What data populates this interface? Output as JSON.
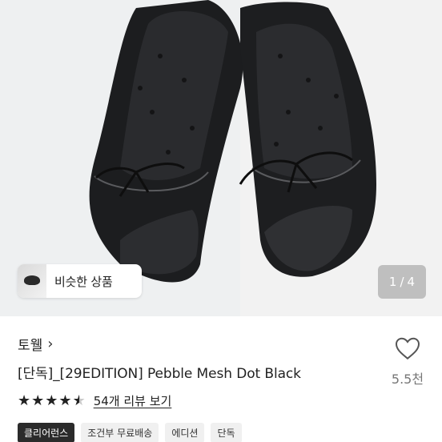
{
  "hero": {
    "similar_button_label": "비슷한 상품",
    "page_current": "1",
    "page_separator": "/",
    "page_total": "4"
  },
  "product": {
    "brand": "토웰",
    "title": "[단독]_[29EDITION] Pebble Mesh Dot Black",
    "like_count": "5.5천",
    "rating": 4.5,
    "review_label": "54개 리뷰 보기",
    "tags": [
      "클리어런스",
      "조건부 무료배송",
      "에디션",
      "단독"
    ]
  },
  "colors": {
    "star": "#222222",
    "tag_dark_bg": "#2b2b2b",
    "tag_bg": "#f0f0f0"
  },
  "icons": [
    "heart-icon",
    "chevron-right-icon",
    "star-icon"
  ]
}
